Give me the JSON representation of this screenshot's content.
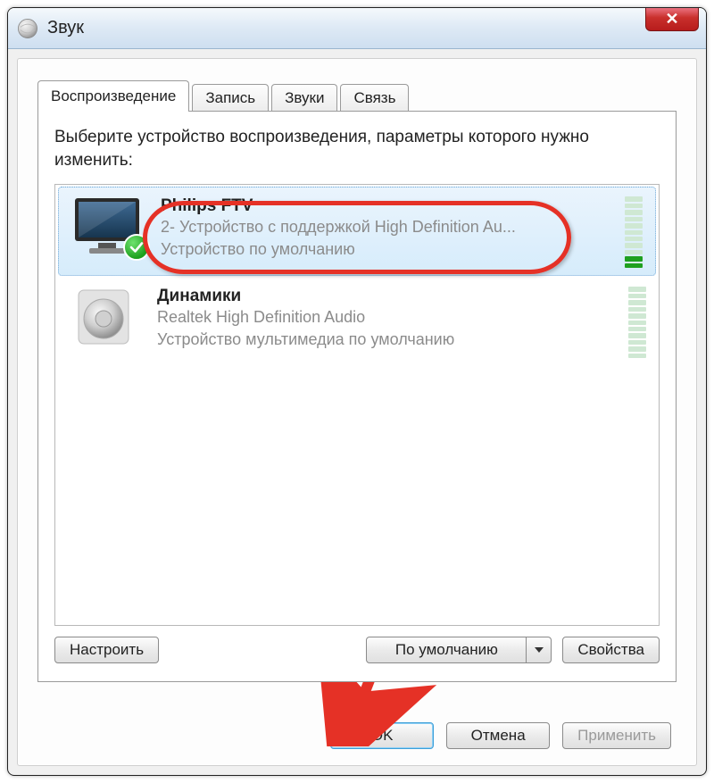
{
  "window": {
    "title": "Звук",
    "close_glyph": "✕"
  },
  "tabs": {
    "playback": "Воспроизведение",
    "recording": "Запись",
    "sounds": "Звуки",
    "communications": "Связь"
  },
  "instruction": "Выберите устройство воспроизведения, параметры которого нужно изменить:",
  "devices": [
    {
      "name": "Philips FTV",
      "line1": "2- Устройство с поддержкой High Definition Au...",
      "line2": "Устройство по умолчанию",
      "selected": true,
      "default_check": true,
      "vu_active_segments": 2
    },
    {
      "name": "Динамики",
      "line1": "Realtek High Definition Audio",
      "line2": "Устройство мультимедиа по умолчанию",
      "selected": false,
      "default_check": false,
      "vu_active_segments": 0
    }
  ],
  "buttons": {
    "configure": "Настроить",
    "set_default": "По умолчанию",
    "properties": "Свойства",
    "ok": "OK",
    "cancel": "Отмена",
    "apply": "Применить"
  },
  "colors": {
    "annotation_red": "#e53126"
  }
}
